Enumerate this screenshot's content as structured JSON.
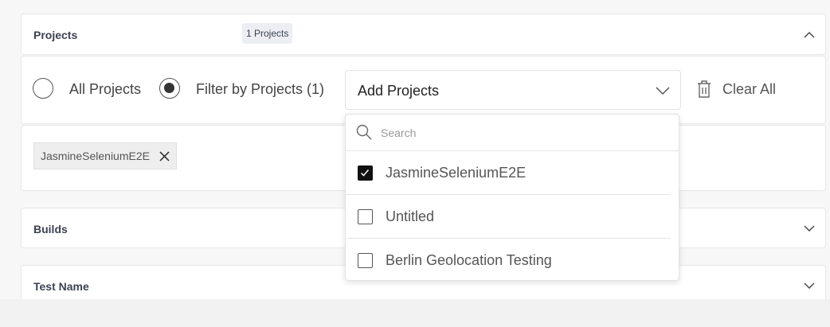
{
  "projects": {
    "title": "Projects",
    "badge": "1 Projects"
  },
  "filter": {
    "all_label": "All Projects",
    "filter_label": "Filter by Projects (1)",
    "select_label": "Add Projects",
    "clear_label": "Clear All"
  },
  "selected_chips": [
    {
      "label": "JasmineSeleniumE2E"
    }
  ],
  "dropdown": {
    "search_placeholder": "Search",
    "options": [
      {
        "label": "JasmineSeleniumE2E",
        "checked": true
      },
      {
        "label": "Untitled",
        "checked": false
      },
      {
        "label": "Berlin Geolocation Testing",
        "checked": false
      }
    ]
  },
  "sections": [
    {
      "title": "Builds"
    },
    {
      "title": "Test Name"
    }
  ]
}
